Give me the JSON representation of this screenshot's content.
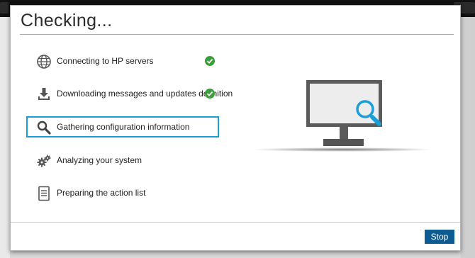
{
  "dialog": {
    "title": "Checking...",
    "steps": [
      {
        "label": "Connecting to HP servers",
        "icon": "globe-icon",
        "status": "done"
      },
      {
        "label": "Downloading messages and updates definition",
        "icon": "download-icon",
        "status": "done"
      },
      {
        "label": "Gathering configuration information",
        "icon": "magnifier-icon",
        "status": "active"
      },
      {
        "label": "Analyzing your system",
        "icon": "gears-icon",
        "status": "pending"
      },
      {
        "label": "Preparing the action list",
        "icon": "document-icon",
        "status": "pending"
      }
    ],
    "stop_label": "Stop"
  },
  "colors": {
    "accent": "#1b9ed7",
    "check": "#3a9e3a",
    "button": "#0e5b92"
  }
}
